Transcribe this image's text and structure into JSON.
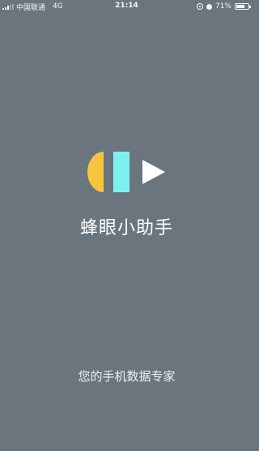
{
  "status_bar": {
    "carrier": "中国联通",
    "network": "4G",
    "time": "21:14",
    "battery_percent": "71%",
    "battery_level": 0.71,
    "icons": [
      "signal-icon",
      "rotation-lock-icon",
      "alarm-icon",
      "battery-icon"
    ]
  },
  "splash": {
    "app_name": "蜂眼小助手",
    "tagline": "您的手机数据专家",
    "logo_colors": {
      "left": "#f7c43d",
      "middle": "#7ff0f2",
      "right": "#ffffff"
    }
  }
}
